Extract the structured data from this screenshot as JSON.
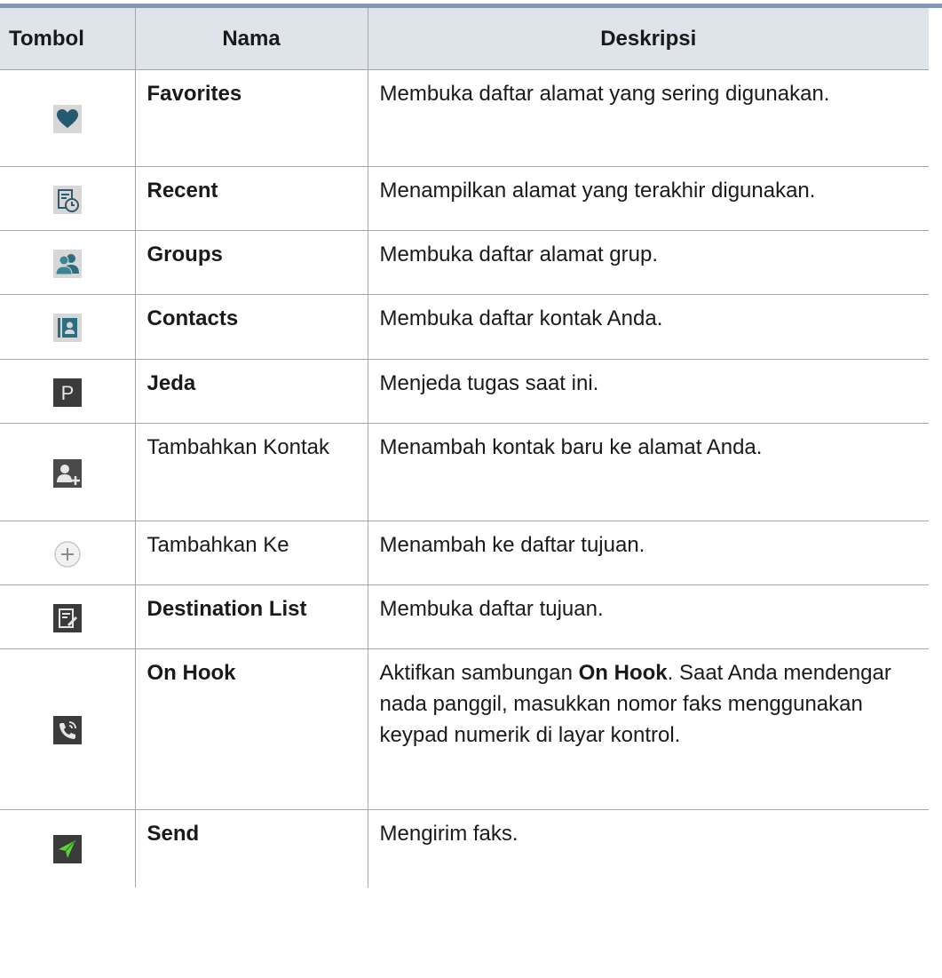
{
  "header": {
    "tombol": "Tombol",
    "nama": "Nama",
    "deskripsi": "Deskripsi"
  },
  "rows": [
    {
      "icon": "heart-icon",
      "name": "Favorites",
      "desc": "Membuka daftar alamat yang sering digunakan."
    },
    {
      "icon": "recent-clock-icon",
      "name": "Recent",
      "desc": "Menampilkan alamat yang terakhir digunakan."
    },
    {
      "icon": "groups-icon",
      "name": "Groups",
      "desc": "Membuka daftar alamat grup."
    },
    {
      "icon": "contacts-icon",
      "name": "Contacts",
      "desc": "Membuka daftar kontak Anda."
    },
    {
      "icon": "pause-p-icon",
      "name": "Jeda",
      "desc": "Menjeda tugas saat ini."
    },
    {
      "icon": "add-contact-icon",
      "name": "Tambahkan Kontak",
      "desc": "Menambah kontak baru ke alamat Anda."
    },
    {
      "icon": "add-circle-icon",
      "name": "Tambahkan Ke",
      "desc": "Menambah ke daftar tujuan."
    },
    {
      "icon": "destination-list-icon",
      "name": "Destination List",
      "desc": "Membuka daftar tujuan."
    },
    {
      "icon": "on-hook-phone-icon",
      "name": "On Hook",
      "desc_before": "Aktifkan sambungan ",
      "desc_bold": "On Hook",
      "desc_after": ". Saat Anda mendengar nada panggil, masukkan nomor faks menggunakan keypad numerik di layar kontrol."
    },
    {
      "icon": "send-arrow-icon",
      "name": "Send",
      "desc": "Mengirim faks."
    }
  ]
}
